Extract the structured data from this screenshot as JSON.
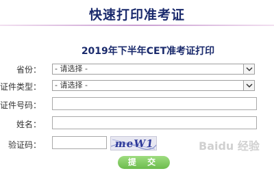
{
  "header": {
    "title": "快速打印准考证"
  },
  "form": {
    "title": "2019年下半年CET准考证打印",
    "province": {
      "label": "省份：",
      "value": "- 请选择 -"
    },
    "id_type": {
      "label": "证件类型：",
      "value": "- 请选择 -"
    },
    "id_number": {
      "label": "证件号码：",
      "value": ""
    },
    "name": {
      "label": "姓名：",
      "value": ""
    },
    "captcha": {
      "label": "验证码：",
      "value": "",
      "image_text": "meW1"
    },
    "submit_label": "提 交"
  },
  "watermark": "Baidu 经验",
  "colors": {
    "title": "#1a2a6c",
    "submit": "#7ec85e",
    "rule": "#c79bd0"
  },
  "icons": {
    "dropdown": "chevron-down-icon"
  }
}
